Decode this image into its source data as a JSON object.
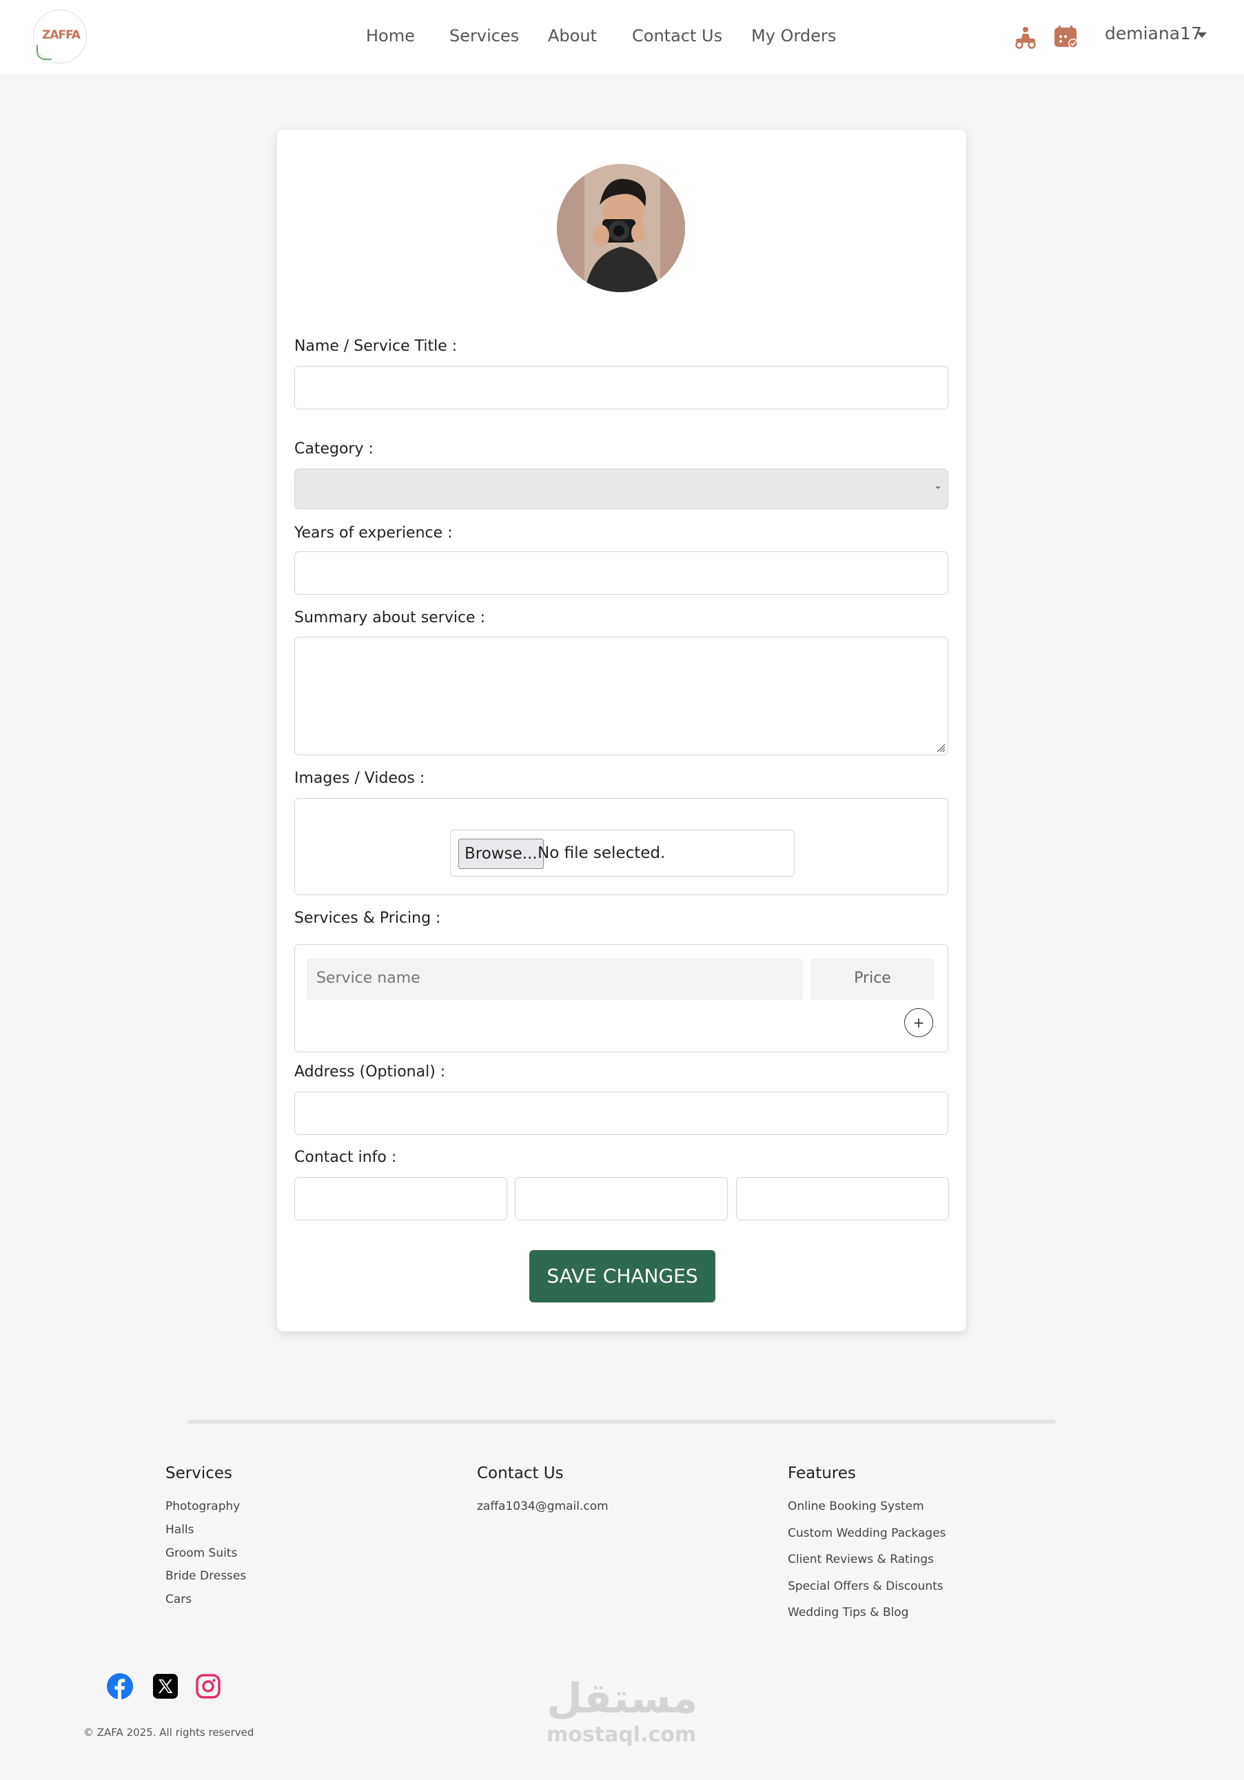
{
  "nav": {
    "logo_text": "ZAFFA",
    "links": [
      "Home",
      "Services",
      "About",
      "Contact Us",
      "My Orders"
    ],
    "username": "demiana17"
  },
  "form": {
    "name_label": "Name / Service Title :",
    "category_label": "Category :",
    "experience_label": "Years of experience :",
    "summary_label": "Summary about service :",
    "media_label": "Images / Videos :",
    "browse_label": "Browse...",
    "no_file_text": "No file selected.",
    "pricing_label": "Services & Pricing :",
    "service_name_placeholder": "Service name",
    "price_placeholder": "Price",
    "add_symbol": "+",
    "address_label": "Address (Optional) :",
    "contact_label": "Contact info :",
    "save_label": "SAVE CHANGES"
  },
  "footer": {
    "services_heading": "Services",
    "services": [
      "Photography",
      "Halls",
      "Groom Suits",
      "Bride Dresses",
      "Cars"
    ],
    "contact_heading": "Contact Us",
    "email": "zaffa1034@gmail.com",
    "features_heading": "Features",
    "features": [
      "Online Booking System",
      "Custom Wedding Packages",
      "Client Reviews & Ratings",
      "Special Offers & Discounts",
      "Wedding Tips & Blog"
    ],
    "social": [
      "facebook-icon",
      "x-icon",
      "instagram-icon"
    ],
    "copyright": "© ZAFA 2025. All rights reserved"
  },
  "watermark": {
    "arabic": "مستقل",
    "latin": "mostaql.com"
  },
  "colors": {
    "accent": "#2d6a4f",
    "brand": "#c4765a",
    "facebook": "#1877f2",
    "instagram": "#e1306c"
  }
}
